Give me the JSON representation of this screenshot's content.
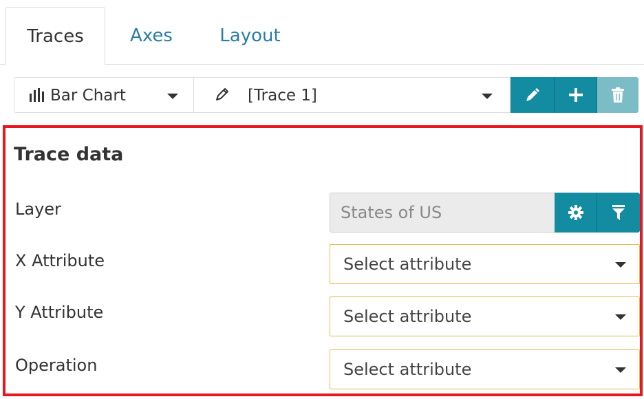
{
  "tabs": [
    {
      "label": "Traces",
      "active": true
    },
    {
      "label": "Axes",
      "active": false
    },
    {
      "label": "Layout",
      "active": false
    }
  ],
  "toolbar": {
    "chart_type": "Bar Chart",
    "chart_type_icon": "bar-chart-icon",
    "trace": "[Trace 1]",
    "trace_icon": "pencil-icon",
    "buttons": [
      {
        "icon": "pencil-icon",
        "action": "edit"
      },
      {
        "icon": "plus-icon",
        "action": "add"
      },
      {
        "icon": "trash-icon",
        "action": "delete"
      }
    ]
  },
  "trace_data": {
    "title": "Trace data",
    "layer": {
      "label": "Layer",
      "value": "States of US",
      "buttons": [
        {
          "icon": "gear-icon"
        },
        {
          "icon": "filter-icon"
        }
      ]
    },
    "x_attribute": {
      "label": "X Attribute",
      "value": "Select attribute"
    },
    "y_attribute": {
      "label": "Y Attribute",
      "value": "Select attribute"
    },
    "operation": {
      "label": "Operation",
      "value": "Select attribute"
    }
  },
  "colors": {
    "accent": "#138ba0",
    "accent_disabled": "#7bbcc7",
    "highlight_border": "#e8171e",
    "select_border": "#e0b84c",
    "link": "#2a7da5"
  }
}
